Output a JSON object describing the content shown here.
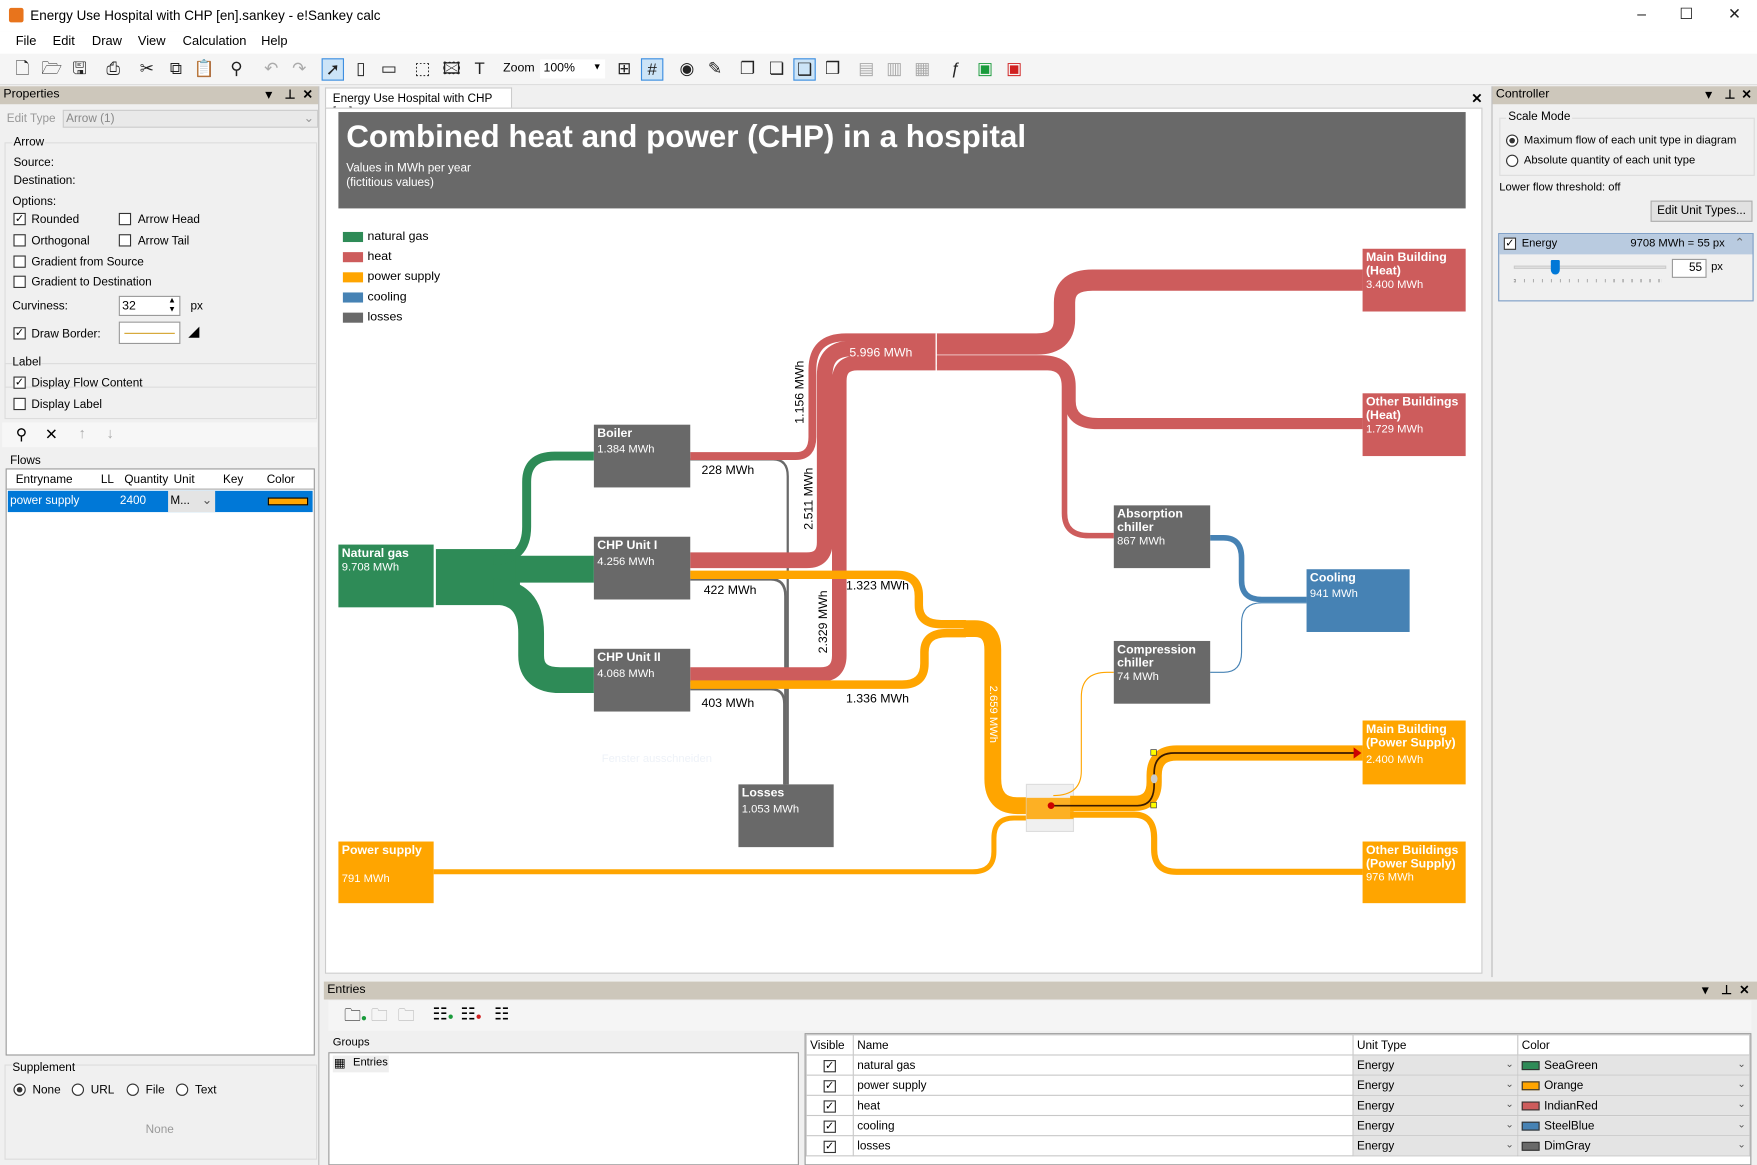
{
  "window": {
    "title": "Energy Use Hospital with CHP [en].sankey - e!Sankey calc",
    "controls": [
      "minimize",
      "maximize",
      "close"
    ]
  },
  "menu": [
    "File",
    "Edit",
    "Draw",
    "View",
    "Calculation",
    "Help"
  ],
  "toolbar": {
    "icons": [
      "new-file",
      "open-folder",
      "save",
      "print",
      "cut",
      "copy",
      "paste",
      "find",
      "undo",
      "redo",
      "select-pointer",
      "draw-node",
      "draw-arrow",
      "draw-process",
      "insert-image",
      "insert-text",
      "align",
      "grid",
      "view-eye",
      "edit",
      "bring-front",
      "bring-forward",
      "send-back",
      "send-backward",
      "excel-export",
      "excel-import",
      "excel-link",
      "formula",
      "calc-run",
      "calc-stop"
    ],
    "zoom_label": "Zoom",
    "zoom_value": "100%"
  },
  "properties": {
    "title": "Properties",
    "edit_type_label": "Edit Type",
    "edit_type_value": "Arrow (1)",
    "arrow_group": "Arrow",
    "source_label": "Source:",
    "destination_label": "Destination:",
    "options_label": "Options:",
    "rounded": {
      "label": "Rounded",
      "checked": true
    },
    "arrow_head": {
      "label": "Arrow Head",
      "checked": false
    },
    "orthogonal": {
      "label": "Orthogonal",
      "checked": false
    },
    "arrow_tail": {
      "label": "Arrow Tail",
      "checked": false
    },
    "gradient_source": {
      "label": "Gradient from Source",
      "checked": false
    },
    "gradient_dest": {
      "label": "Gradient to Destination",
      "checked": false
    },
    "curviness_label": "Curviness:",
    "curviness_value": "32",
    "px": "px",
    "draw_border": {
      "label": "Draw Border:",
      "checked": true
    },
    "label_group": "Label",
    "display_flow_content": {
      "label": "Display Flow Content",
      "checked": true
    },
    "display_label": {
      "label": "Display Label",
      "checked": false
    },
    "flows_label": "Flows",
    "flows_columns": [
      "Entryname",
      "LL",
      "Quantity",
      "Unit",
      "Key",
      "Color"
    ],
    "flows_rows": [
      {
        "entryname": "power supply",
        "ll": "",
        "quantity": "2400",
        "unit": "M...",
        "key": "",
        "color": "#ffa500"
      }
    ],
    "supplement_label": "Supplement",
    "supplement_options": [
      "None",
      "URL",
      "File",
      "Text"
    ],
    "supplement_selected": "None",
    "supplement_value": "None"
  },
  "document": {
    "tab": "Energy Use Hospital with CHP [en]"
  },
  "diagram": {
    "title": "Combined heat and power (CHP) in a hospital",
    "subtitle1": "Values in MWh per year",
    "subtitle2": "(fictitious values)",
    "legend": [
      {
        "label": "natural gas",
        "color": "#2e8b57"
      },
      {
        "label": "heat",
        "color": "#cd5c5c"
      },
      {
        "label": "power supply",
        "color": "#ffa500"
      },
      {
        "label": "cooling",
        "color": "#4682b4"
      },
      {
        "label": "losses",
        "color": "#696969"
      }
    ],
    "nodes": {
      "natural_gas": {
        "name": "Natural gas",
        "value": "9.708 MWh"
      },
      "boiler": {
        "name": "Boiler",
        "value": "1.384 MWh"
      },
      "chp1": {
        "name": "CHP Unit I",
        "value": "4.256 MWh"
      },
      "chp2": {
        "name": "CHP Unit II",
        "value": "4.068 MWh"
      },
      "losses": {
        "name": "Losses",
        "value": "1.053 MWh"
      },
      "power_supply": {
        "name": "Power supply",
        "value": "791 MWh"
      },
      "main_heat": {
        "name": "Main Building (Heat)",
        "value": "3.400 MWh"
      },
      "other_heat": {
        "name": "Other Buildings (Heat)",
        "value": "1.729 MWh"
      },
      "absorption": {
        "name": "Absorption chiller",
        "value": "867 MWh"
      },
      "compression": {
        "name": "Compression chiller",
        "value": "74 MWh"
      },
      "cooling": {
        "name": "Cooling",
        "value": "941 MWh"
      },
      "main_power": {
        "name": "Main Building (Power Supply)",
        "value": "2.400 MWh"
      },
      "other_power": {
        "name": "Other Buildings (Power Supply)",
        "value": "976 MWh"
      }
    },
    "flow_labels": {
      "heat_total": "5.996 MWh",
      "boiler_heat": "1.156 MWh",
      "chp1_heat": "2.511 MWh",
      "chp2_heat": "2.329 MWh",
      "boiler_loss": "228 MWh",
      "chp1_loss": "422 MWh",
      "chp2_loss": "403 MWh",
      "chp1_power": "1.323 MWh",
      "chp2_power": "1.336 MWh",
      "chp_power_total": "2.659 MWh"
    },
    "watermark": "Fenster ausschneiden"
  },
  "controller": {
    "title": "Controller",
    "scale_mode_label": "Scale Mode",
    "mode_max": "Maximum flow of each unit type in diagram",
    "mode_abs": "Absolute quantity of each unit type",
    "selected_mode": "max",
    "threshold": "Lower flow threshold: off",
    "edit_unit_types": "Edit Unit Types...",
    "unit": {
      "name": "Energy",
      "checked": true,
      "scale_text": "9708 MWh = 55 px",
      "px_value": "55",
      "px": "px",
      "slider_level": 0.3
    }
  },
  "entries": {
    "title": "Entries",
    "groups_label": "Groups",
    "group_items": [
      "Entries"
    ],
    "columns": [
      "Visible",
      "Name",
      "Unit Type",
      "Color"
    ],
    "rows": [
      {
        "visible": true,
        "name": "natural gas",
        "unit_type": "Energy",
        "color_name": "SeaGreen",
        "color": "#2e8b57"
      },
      {
        "visible": true,
        "name": "power supply",
        "unit_type": "Energy",
        "color_name": "Orange",
        "color": "#ffa500"
      },
      {
        "visible": true,
        "name": "heat",
        "unit_type": "Energy",
        "color_name": "IndianRed",
        "color": "#cd5c5c"
      },
      {
        "visible": true,
        "name": "cooling",
        "unit_type": "Energy",
        "color_name": "SteelBlue",
        "color": "#4682b4"
      },
      {
        "visible": true,
        "name": "losses",
        "unit_type": "Energy",
        "color_name": "DimGray",
        "color": "#696969"
      }
    ]
  }
}
